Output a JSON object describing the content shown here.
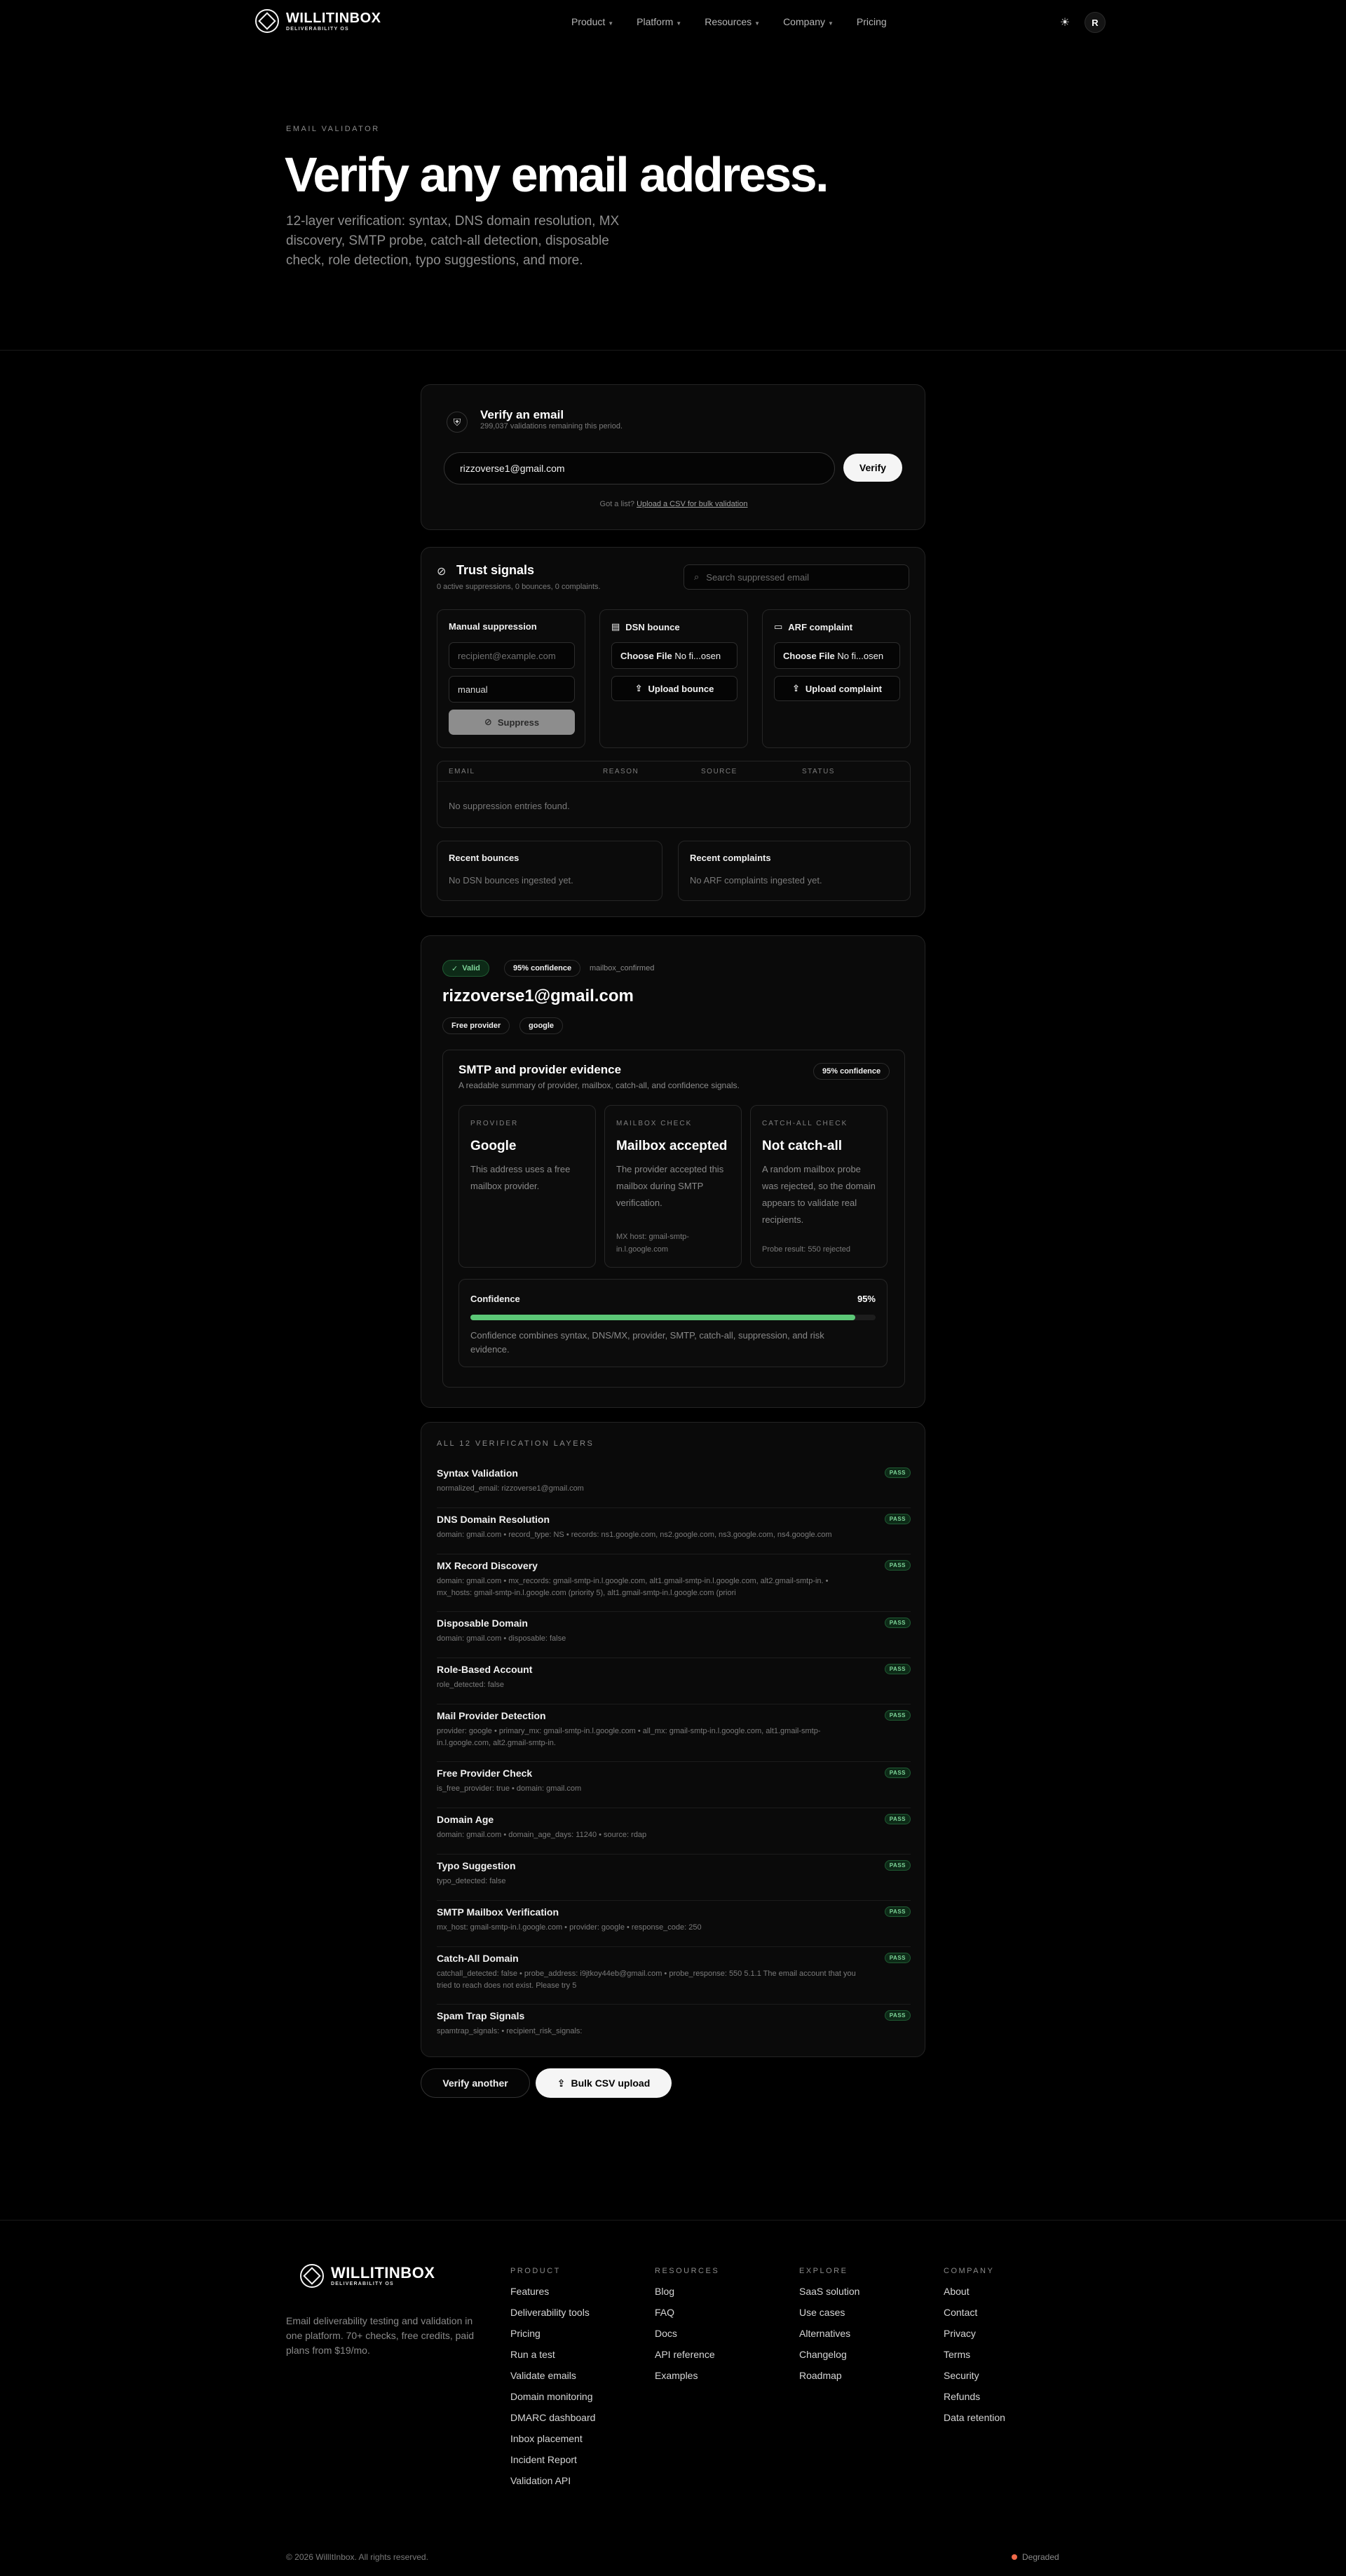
{
  "nav": {
    "brand": "WILLITINBOX",
    "brand_sub": "DELIVERABILITY OS",
    "links": [
      {
        "label": "Product",
        "has_menu": true
      },
      {
        "label": "Platform",
        "has_menu": true
      },
      {
        "label": "Resources",
        "has_menu": true
      },
      {
        "label": "Company",
        "has_menu": true
      },
      {
        "label": "Pricing",
        "has_menu": false
      }
    ],
    "theme_icon": "sun-icon",
    "avatar_initial": "R"
  },
  "hero": {
    "eyebrow": "EMAIL VALIDATOR",
    "title": "Verify any email address.",
    "subtitle": "12-layer verification: syntax, DNS domain resolution, MX discovery, SMTP probe, catch-all detection, disposable check, role detection, typo suggestions, and more."
  },
  "verify": {
    "title": "Verify an email",
    "remaining": "299,037 validations remaining this period.",
    "email_value": "rizzoverse1@gmail.com",
    "button": "Verify",
    "csv_prefix": "Got a list? ",
    "csv_link": "Upload a CSV for bulk validation"
  },
  "trust": {
    "title": "Trust signals",
    "stats": "0 active suppressions, 0 bounces, 0 complaints.",
    "search_placeholder": "Search suppressed email",
    "manual": {
      "title": "Manual suppression",
      "email_placeholder": "recipient@example.com",
      "reason_value": "manual",
      "button": "Suppress"
    },
    "dsn": {
      "title": "DSN bounce",
      "file_button": "Choose File",
      "file_status": "No fi...osen",
      "upload": "Upload bounce"
    },
    "arf": {
      "title": "ARF complaint",
      "file_button": "Choose File",
      "file_status": "No fi...osen",
      "upload": "Upload complaint"
    },
    "table": {
      "columns": [
        "EMAIL",
        "REASON",
        "SOURCE",
        "STATUS"
      ],
      "empty": "No suppression entries found."
    },
    "recent_bounces": {
      "title": "Recent bounces",
      "empty": "No DSN bounces ingested yet."
    },
    "recent_complaints": {
      "title": "Recent complaints",
      "empty": "No ARF complaints ingested yet."
    }
  },
  "result": {
    "status": "Valid",
    "confidence_badge": "95% confidence",
    "reason": "mailbox_confirmed",
    "email": "rizzoverse1@gmail.com",
    "tags": [
      "Free provider",
      "google"
    ],
    "evidence": {
      "title": "SMTP and provider evidence",
      "subtitle": "A readable summary of provider, mailbox, catch-all, and confidence signals.",
      "badge": "95% confidence",
      "provider": {
        "label": "PROVIDER",
        "value": "Google",
        "desc": "This address uses a free mailbox provider."
      },
      "mailbox": {
        "label": "MAILBOX CHECK",
        "value": "Mailbox accepted",
        "desc": "The provider accepted this mailbox during SMTP verification.",
        "foot": "MX host: gmail-smtp-in.l.google.com"
      },
      "catchall": {
        "label": "CATCH-ALL CHECK",
        "value": "Not catch-all",
        "desc": "A random mailbox probe was rejected, so the domain appears to validate real recipients.",
        "foot": "Probe result: 550 rejected"
      },
      "confidence": {
        "label": "Confidence",
        "value_text": "95%",
        "value": 0.95,
        "desc": "Confidence combines syntax, DNS/MX, provider, SMTP, catch-all, suppression, and risk evidence."
      }
    }
  },
  "layers": {
    "heading": "ALL 12 VERIFICATION LAYERS",
    "items": [
      {
        "name": "Syntax Validation",
        "detail": "normalized_email: rizzoverse1@gmail.com",
        "status": "PASS"
      },
      {
        "name": "DNS Domain Resolution",
        "detail": "domain: gmail.com • record_type: NS • records: ns1.google.com, ns2.google.com, ns3.google.com, ns4.google.com",
        "status": "PASS"
      },
      {
        "name": "MX Record Discovery",
        "detail": "domain: gmail.com • mx_records: gmail-smtp-in.l.google.com, alt1.gmail-smtp-in.l.google.com, alt2.gmail-smtp-in. • mx_hosts: gmail-smtp-in.l.google.com (priority 5), alt1.gmail-smtp-in.l.google.com (priori",
        "status": "PASS"
      },
      {
        "name": "Disposable Domain",
        "detail": "domain: gmail.com • disposable: false",
        "status": "PASS"
      },
      {
        "name": "Role-Based Account",
        "detail": "role_detected: false",
        "status": "PASS"
      },
      {
        "name": "Mail Provider Detection",
        "detail": "provider: google • primary_mx: gmail-smtp-in.l.google.com • all_mx: gmail-smtp-in.l.google.com, alt1.gmail-smtp-in.l.google.com, alt2.gmail-smtp-in.",
        "status": "PASS"
      },
      {
        "name": "Free Provider Check",
        "detail": "is_free_provider: true • domain: gmail.com",
        "status": "PASS"
      },
      {
        "name": "Domain Age",
        "detail": "domain: gmail.com • domain_age_days: 11240 • source: rdap",
        "status": "PASS"
      },
      {
        "name": "Typo Suggestion",
        "detail": "typo_detected: false",
        "status": "PASS"
      },
      {
        "name": "SMTP Mailbox Verification",
        "detail": "mx_host: gmail-smtp-in.l.google.com • provider: google • response_code: 250",
        "status": "PASS"
      },
      {
        "name": "Catch-All Domain",
        "detail": "catchall_detected: false • probe_address: i9jtkoy44eb@gmail.com • probe_response: 550 5.1.1 The email account that you tried to reach does not exist. Please try 5",
        "status": "PASS"
      },
      {
        "name": "Spam Trap Signals",
        "detail": "spamtrap_signals: • recipient_risk_signals:",
        "status": "PASS"
      }
    ]
  },
  "actions": {
    "verify_another": "Verify another",
    "bulk": "Bulk CSV upload"
  },
  "footer": {
    "brand": "WILLITINBOX",
    "brand_sub": "DELIVERABILITY OS",
    "tagline": "Email deliverability testing and validation in one platform. 70+ checks, free credits, paid plans from $19/mo.",
    "columns": [
      {
        "heading": "PRODUCT",
        "items": [
          "Features",
          "Deliverability tools",
          "Pricing",
          "Run a test",
          "Validate emails",
          "Domain monitoring",
          "DMARC dashboard",
          "Inbox placement",
          "Incident Report",
          "Validation API"
        ]
      },
      {
        "heading": "RESOURCES",
        "items": [
          "Blog",
          "FAQ",
          "Docs",
          "API reference",
          "Examples"
        ]
      },
      {
        "heading": "EXPLORE",
        "items": [
          "SaaS solution",
          "Use cases",
          "Alternatives",
          "Changelog",
          "Roadmap"
        ]
      },
      {
        "heading": "COMPANY",
        "items": [
          "About",
          "Contact",
          "Privacy",
          "Terms",
          "Security",
          "Refunds",
          "Data retention"
        ]
      }
    ],
    "copyright": "© 2026 WillItInbox. All rights reserved.",
    "status": "Degraded",
    "status_color": "#f06a4a"
  }
}
